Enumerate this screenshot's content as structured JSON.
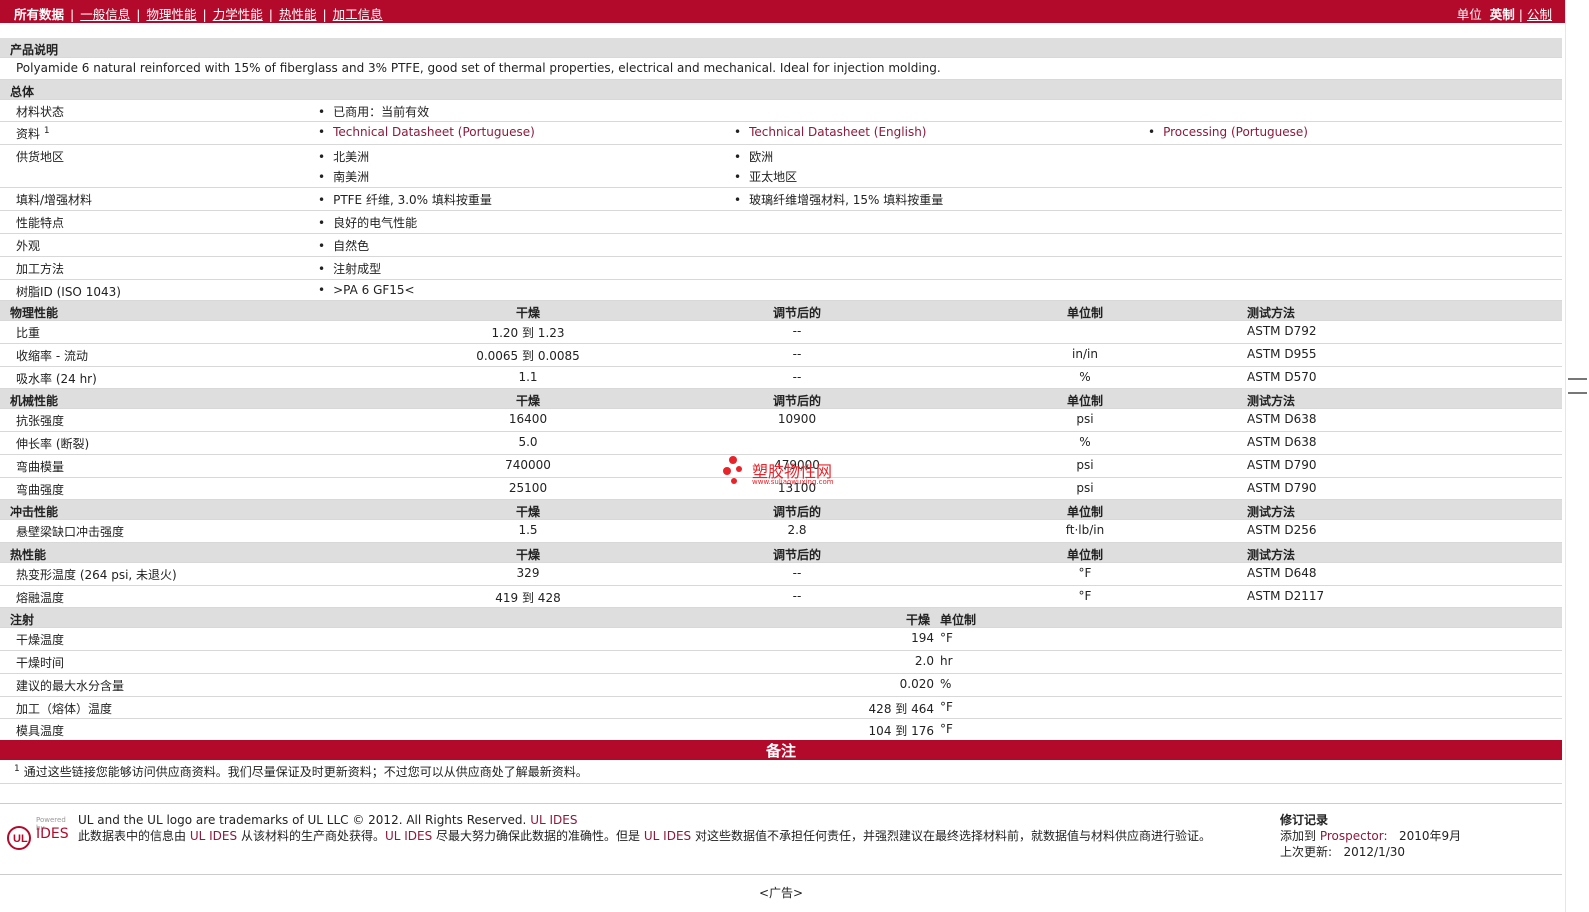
{
  "nav": {
    "tabs": [
      "所有数据",
      "一般信息",
      "物理性能",
      "力学性能",
      "热性能",
      "加工信息"
    ],
    "units_label": "单位",
    "unit_options": [
      "英制",
      "公制"
    ]
  },
  "description": {
    "header": "产品说明",
    "text": "Polyamide 6 natural reinforced with 15% of fiberglass and 3% PTFE, good set of thermal properties, electrical and mechanical. Ideal for injection molding."
  },
  "general": {
    "header": "总体",
    "rows": [
      {
        "label": "材料状态",
        "items": [
          "已商用：当前有效"
        ]
      },
      {
        "label": "资料",
        "sup": "1",
        "links": [
          "Technical Datasheet (Portuguese)",
          "Technical Datasheet (English)",
          "Processing (Portuguese)"
        ]
      },
      {
        "label": "供货地区",
        "items": [
          "北美洲",
          "欧洲",
          "南美洲",
          "亚太地区"
        ]
      },
      {
        "label": "填料/增强材料",
        "items": [
          "PTFE 纤维, 3.0% 填料按重量",
          "玻璃纤维增强材料, 15% 填料按重量"
        ]
      },
      {
        "label": "性能特点",
        "items": [
          "良好的电气性能"
        ]
      },
      {
        "label": "外观",
        "items": [
          "自然色"
        ]
      },
      {
        "label": "加工方法",
        "items": [
          "注射成型"
        ]
      },
      {
        "label": "树脂ID (ISO 1043)",
        "items": [
          ">PA 6 GF15<"
        ]
      }
    ]
  },
  "cols": {
    "dry": "干燥",
    "cond": "调节后的",
    "unit": "单位制",
    "test": "测试方法"
  },
  "sections": [
    {
      "header": "物理性能",
      "rows": [
        {
          "label": "比重",
          "dry": "1.20 到  1.23",
          "cond": "--",
          "unit": "",
          "test": "ASTM D792"
        },
        {
          "label": "收缩率  - 流动",
          "dry": "0.0065 到  0.0085",
          "cond": "--",
          "unit": "in/in",
          "test": "ASTM D955"
        },
        {
          "label": "吸水率  (24 hr)",
          "dry": "1.1",
          "cond": "--",
          "unit": "%",
          "test": "ASTM D570"
        }
      ]
    },
    {
      "header": "机械性能",
      "rows": [
        {
          "label": "抗张强度",
          "dry": "16400",
          "cond": "10900",
          "unit": "psi",
          "test": "ASTM D638"
        },
        {
          "label": "伸长率  (断裂)",
          "dry": "5.0",
          "cond": "",
          "unit": "%",
          "test": "ASTM D638"
        },
        {
          "label": "弯曲模量",
          "dry": "740000",
          "cond": "479000",
          "unit": "psi",
          "test": "ASTM D790"
        },
        {
          "label": "弯曲强度",
          "dry": "25100",
          "cond": "13100",
          "unit": "psi",
          "test": "ASTM D790"
        }
      ]
    },
    {
      "header": "冲击性能",
      "rows": [
        {
          "label": "悬壁梁缺口冲击强度",
          "dry": "1.5",
          "cond": "2.8",
          "unit": "ft·lb/in",
          "test": "ASTM D256"
        }
      ]
    },
    {
      "header": "热性能",
      "rows": [
        {
          "label": "热变形温度  (264 psi, 未退火)",
          "dry": "329",
          "cond": "--",
          "unit": "°F",
          "test": "ASTM D648"
        },
        {
          "label": "熔融温度",
          "dry": "419 到  428",
          "cond": "--",
          "unit": "°F",
          "test": "ASTM D2117"
        }
      ]
    }
  ],
  "injection": {
    "header": "注射",
    "col_dry": "干燥",
    "col_unit": "单位制",
    "rows": [
      {
        "label": "干燥温度",
        "value": "194",
        "unit": "°F"
      },
      {
        "label": "干燥时间",
        "value": "2.0",
        "unit": "hr"
      },
      {
        "label": "建议的最大水分含量",
        "value": "0.020",
        "unit": "%"
      },
      {
        "label": "加工（熔体）温度",
        "value": "428 到  464",
        "unit": "°F"
      },
      {
        "label": "模具温度",
        "value": "104 到  176",
        "unit": "°F"
      }
    ]
  },
  "remarks": {
    "title": "备注",
    "note_sup": "1",
    "note": "通过这些链接您能够访问供应商资料。我们尽量保证及时更新资料；不过您可以从供应商处了解最新资料。"
  },
  "footer": {
    "logo_small": "Powered by",
    "logo_text": "IDES",
    "trademark": "UL and the UL logo are trademarks of UL LLC © 2012. All Rights Reserved.",
    "trademark_link": "UL IDES",
    "disclaimer_1": "此数据表中的信息由",
    "disclaimer_link1": "UL IDES",
    "disclaimer_2": "从该材料的生产商处获得。",
    "disclaimer_link2": "UL IDES",
    "disclaimer_3": "尽最大努力确保此数据的准确性。但是",
    "disclaimer_link3": "UL IDES",
    "disclaimer_4": "对这些数据值不承担任何责任，并强烈建议在最终选择材料前，就数据值与材料供应商进行验证。",
    "rev_title": "修订记录",
    "added_label": "添加到",
    "added_link": "Prospector:",
    "added_date": "2010年9月",
    "updated_label": "上次更新:",
    "updated_date": "2012/1/30"
  },
  "ad": "<广告>",
  "watermark": {
    "title": "塑胶物性网",
    "url": "www.suliaowuxing.com"
  },
  "colors": {
    "brand_red": "#b30a2b",
    "link": "#8b1a3c",
    "header_gray": "#dedede"
  }
}
